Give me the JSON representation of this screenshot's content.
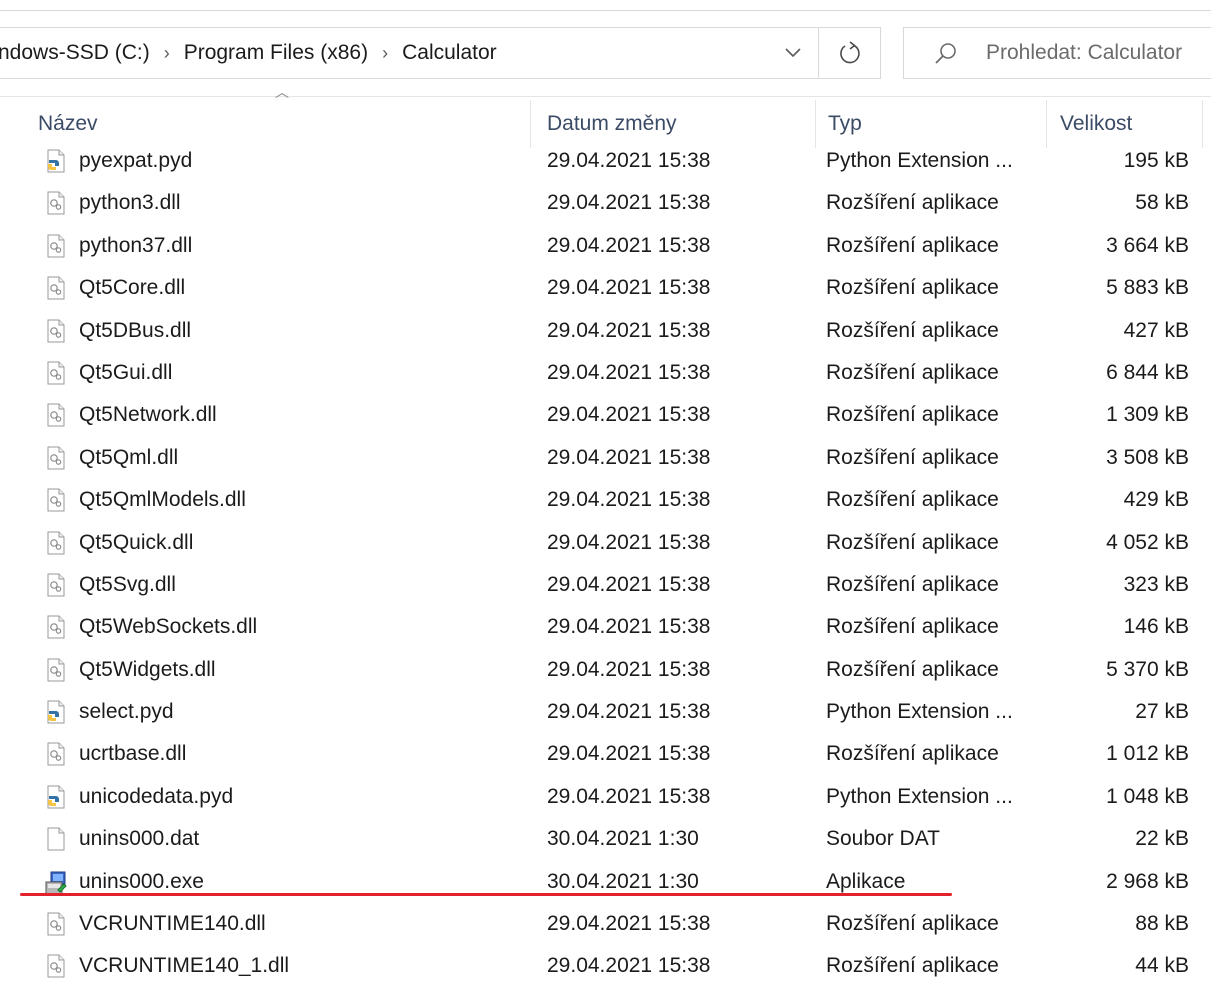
{
  "breadcrumb": {
    "items": [
      "ndows-SSD (C:)",
      "Program Files (x86)",
      "Calculator"
    ],
    "separator": "›"
  },
  "search": {
    "placeholder": "Prohledat: Calculator"
  },
  "columns": {
    "name": "Název",
    "date": "Datum změny",
    "type": "Typ",
    "size": "Velikost"
  },
  "files": [
    {
      "name": "pyexpat.pyd",
      "date": "29.04.2021 15:38",
      "type": "Python Extension ...",
      "size": "195 kB",
      "icon": "python-file-icon"
    },
    {
      "name": "python3.dll",
      "date": "29.04.2021 15:38",
      "type": "Rozšíření aplikace",
      "size": "58 kB",
      "icon": "dll-file-icon"
    },
    {
      "name": "python37.dll",
      "date": "29.04.2021 15:38",
      "type": "Rozšíření aplikace",
      "size": "3 664 kB",
      "icon": "dll-file-icon"
    },
    {
      "name": "Qt5Core.dll",
      "date": "29.04.2021 15:38",
      "type": "Rozšíření aplikace",
      "size": "5 883 kB",
      "icon": "dll-file-icon"
    },
    {
      "name": "Qt5DBus.dll",
      "date": "29.04.2021 15:38",
      "type": "Rozšíření aplikace",
      "size": "427 kB",
      "icon": "dll-file-icon"
    },
    {
      "name": "Qt5Gui.dll",
      "date": "29.04.2021 15:38",
      "type": "Rozšíření aplikace",
      "size": "6 844 kB",
      "icon": "dll-file-icon"
    },
    {
      "name": "Qt5Network.dll",
      "date": "29.04.2021 15:38",
      "type": "Rozšíření aplikace",
      "size": "1 309 kB",
      "icon": "dll-file-icon"
    },
    {
      "name": "Qt5Qml.dll",
      "date": "29.04.2021 15:38",
      "type": "Rozšíření aplikace",
      "size": "3 508 kB",
      "icon": "dll-file-icon"
    },
    {
      "name": "Qt5QmlModels.dll",
      "date": "29.04.2021 15:38",
      "type": "Rozšíření aplikace",
      "size": "429 kB",
      "icon": "dll-file-icon"
    },
    {
      "name": "Qt5Quick.dll",
      "date": "29.04.2021 15:38",
      "type": "Rozšíření aplikace",
      "size": "4 052 kB",
      "icon": "dll-file-icon"
    },
    {
      "name": "Qt5Svg.dll",
      "date": "29.04.2021 15:38",
      "type": "Rozšíření aplikace",
      "size": "323 kB",
      "icon": "dll-file-icon"
    },
    {
      "name": "Qt5WebSockets.dll",
      "date": "29.04.2021 15:38",
      "type": "Rozšíření aplikace",
      "size": "146 kB",
      "icon": "dll-file-icon"
    },
    {
      "name": "Qt5Widgets.dll",
      "date": "29.04.2021 15:38",
      "type": "Rozšíření aplikace",
      "size": "5 370 kB",
      "icon": "dll-file-icon"
    },
    {
      "name": "select.pyd",
      "date": "29.04.2021 15:38",
      "type": "Python Extension ...",
      "size": "27 kB",
      "icon": "python-file-icon"
    },
    {
      "name": "ucrtbase.dll",
      "date": "29.04.2021 15:38",
      "type": "Rozšíření aplikace",
      "size": "1 012 kB",
      "icon": "dll-file-icon"
    },
    {
      "name": "unicodedata.pyd",
      "date": "29.04.2021 15:38",
      "type": "Python Extension ...",
      "size": "1 048 kB",
      "icon": "python-file-icon"
    },
    {
      "name": "unins000.dat",
      "date": "30.04.2021 1:30",
      "type": "Soubor DAT",
      "size": "22 kB",
      "icon": "blank-file-icon"
    },
    {
      "name": "unins000.exe",
      "date": "30.04.2021 1:30",
      "type": "Aplikace",
      "size": "2 968 kB",
      "icon": "installer-exe-icon"
    },
    {
      "name": "VCRUNTIME140.dll",
      "date": "29.04.2021 15:38",
      "type": "Rozšíření aplikace",
      "size": "88 kB",
      "icon": "dll-file-icon"
    },
    {
      "name": "VCRUNTIME140_1.dll",
      "date": "29.04.2021 15:38",
      "type": "Rozšíření aplikace",
      "size": "44 kB",
      "icon": "dll-file-icon"
    }
  ],
  "highlight": {
    "row_name": "unins000.exe",
    "color": "#e3212d"
  },
  "colors": {
    "header_text": "#3b4b66",
    "border": "#d9d9d9"
  }
}
